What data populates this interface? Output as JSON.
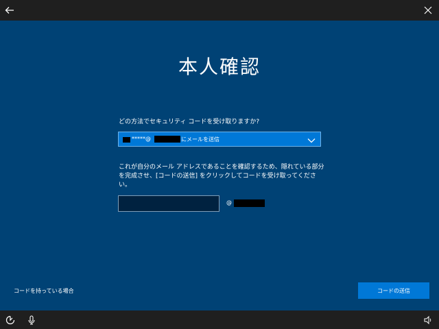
{
  "page": {
    "title": "本人確認",
    "question": "どの方法でセキュリティ コードを受け取りますか?",
    "method": {
      "masked_local": "*****@",
      "selected_suffix": "にメールを送信"
    },
    "description": "これが自分のメール アドレスであることを確認するため、隠れている部分を完成させ、[コードの送信] をクリックしてコードを受け取ってください。",
    "input": {
      "value": "",
      "placeholder": ""
    },
    "domain_at": "@",
    "have_code_link": "コードを持っている場合",
    "send_button": "コードの送信"
  },
  "colors": {
    "background": "#004275",
    "accent": "#0078d7",
    "bar": "#1f1f1f"
  },
  "icons": {
    "top_left": "back-arrow-icon",
    "top_right": "close-icon",
    "bottom_left": "ease-of-access-icon",
    "bottom_left_2": "microphone-icon",
    "bottom_right": "volume-icon"
  }
}
